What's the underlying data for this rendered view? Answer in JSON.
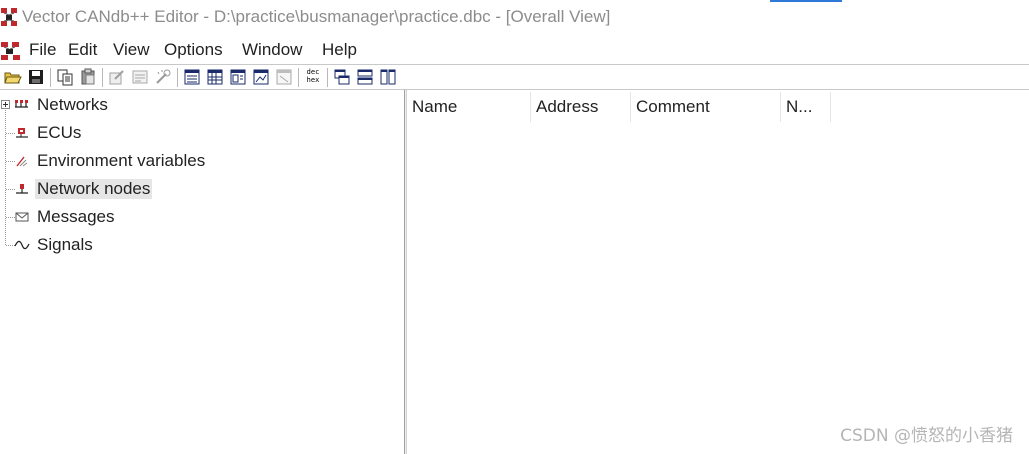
{
  "window": {
    "title": "Vector CANdb++ Editor - D:\\practice\\busmanager\\practice.dbc - [Overall View]",
    "app_icon": "candb-app-icon",
    "accent_color": "#2f7ad8"
  },
  "menu": {
    "doc_icon": "candb-doc-icon",
    "items": [
      "File",
      "Edit",
      "View",
      "Options",
      "Window",
      "Help"
    ]
  },
  "toolbar": {
    "buttons": [
      "open-folder-icon",
      "save-icon",
      "copy-icon",
      "paste-icon",
      "edit-object-icon",
      "properties-icon",
      "wizard-icon",
      "view-list-icon",
      "view-table-icon",
      "view-details-icon",
      "view-graph-icon",
      "view-disabled-icon",
      "dec-hex-toggle",
      "cascade-windows-icon",
      "tile-horizontal-icon",
      "tile-vertical-icon"
    ],
    "dechex_label_top": "dec",
    "dechex_label_bottom": "hex"
  },
  "tree": {
    "items": [
      {
        "label": "Networks",
        "icon": "networks-icon",
        "expandable": true
      },
      {
        "label": "ECUs",
        "icon": "ecu-icon"
      },
      {
        "label": "Environment variables",
        "icon": "env-variable-icon"
      },
      {
        "label": "Network nodes",
        "icon": "network-node-icon",
        "selected": true
      },
      {
        "label": "Messages",
        "icon": "message-envelope-icon"
      },
      {
        "label": "Signals",
        "icon": "signal-wave-icon"
      }
    ]
  },
  "list": {
    "columns": [
      "Name",
      "Address",
      "Comment",
      "N..."
    ]
  },
  "watermark": "CSDN @愤怒的小香猪"
}
